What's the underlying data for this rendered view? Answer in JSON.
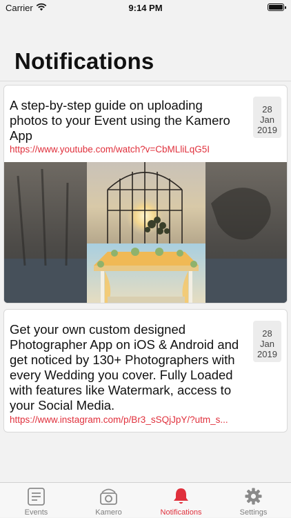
{
  "status_bar": {
    "carrier": "Carrier",
    "time": "9:14 PM"
  },
  "page": {
    "title": "Notifications"
  },
  "notifications": [
    {
      "title": "A step-by-step guide on uploading photos to your Event using the Kamero App",
      "link": "https://www.youtube.com/watch?v=CbMLliLqG5I",
      "date": {
        "day": "28",
        "month": "Jan",
        "year": "2019"
      },
      "has_image": true
    },
    {
      "title": "Get your own custom designed Photographer App on iOS & Android and get noticed by 130+ Photographers with every Wedding you cover. Fully Loaded with features like Watermark, access to your Social Media.",
      "link": "https://www.instagram.com/p/Br3_sSQjJpY/?utm_s...",
      "date": {
        "day": "28",
        "month": "Jan",
        "year": "2019"
      },
      "has_image": false
    }
  ],
  "tab_bar": {
    "items": [
      {
        "label": "Events",
        "icon": "events-list-icon",
        "active": false
      },
      {
        "label": "Kamero",
        "icon": "camera-icon",
        "active": false
      },
      {
        "label": "Notifications",
        "icon": "bell-icon",
        "active": true
      },
      {
        "label": "Settings",
        "icon": "gear-icon",
        "active": false
      }
    ]
  },
  "colors": {
    "accent": "#e0303c",
    "inactive": "#7d7d7d",
    "background": "#f2f2f2"
  }
}
